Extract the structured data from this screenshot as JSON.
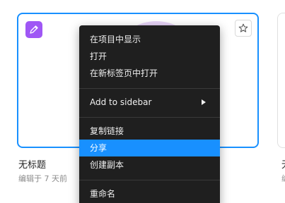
{
  "file_card": {
    "name": "无标题",
    "meta": "编辑于 7 天前",
    "type_icon": "pencil-icon",
    "star_icon": "star-icon",
    "accent_color": "#1890ff",
    "type_color": "#9f57f5"
  },
  "next_card": {
    "name": "无",
    "meta": "编"
  },
  "context_menu": {
    "items": [
      {
        "label": "在项目中显示"
      },
      {
        "label": "打开"
      },
      {
        "label": "在新标签页中打开"
      },
      {
        "label": "Add to sidebar",
        "submenu_icon": "chevron-right-icon"
      },
      {
        "label": "复制链接"
      },
      {
        "label": "分享",
        "highlighted": true
      },
      {
        "label": "创建副本"
      },
      {
        "label": "重命名"
      }
    ],
    "highlight_color": "#1890ff"
  }
}
